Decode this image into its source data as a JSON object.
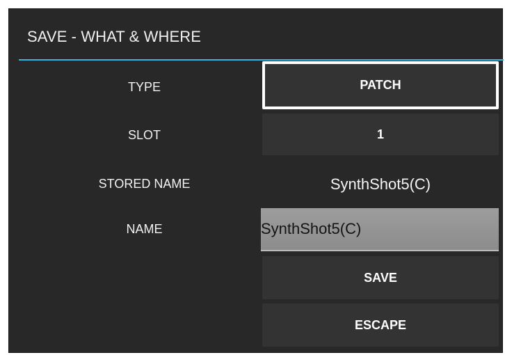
{
  "dialog": {
    "title": "SAVE - WHAT & WHERE",
    "accent_color": "#33b5e5"
  },
  "rows": {
    "type": {
      "label": "TYPE",
      "value": "PATCH"
    },
    "slot": {
      "label": "SLOT",
      "value": "1"
    },
    "stored_name": {
      "label": "STORED NAME",
      "value": "SynthShot5(C)"
    },
    "name": {
      "label": "NAME",
      "value": "SynthShot5(C)"
    }
  },
  "actions": {
    "save_label": "SAVE",
    "escape_label": "ESCAPE"
  }
}
